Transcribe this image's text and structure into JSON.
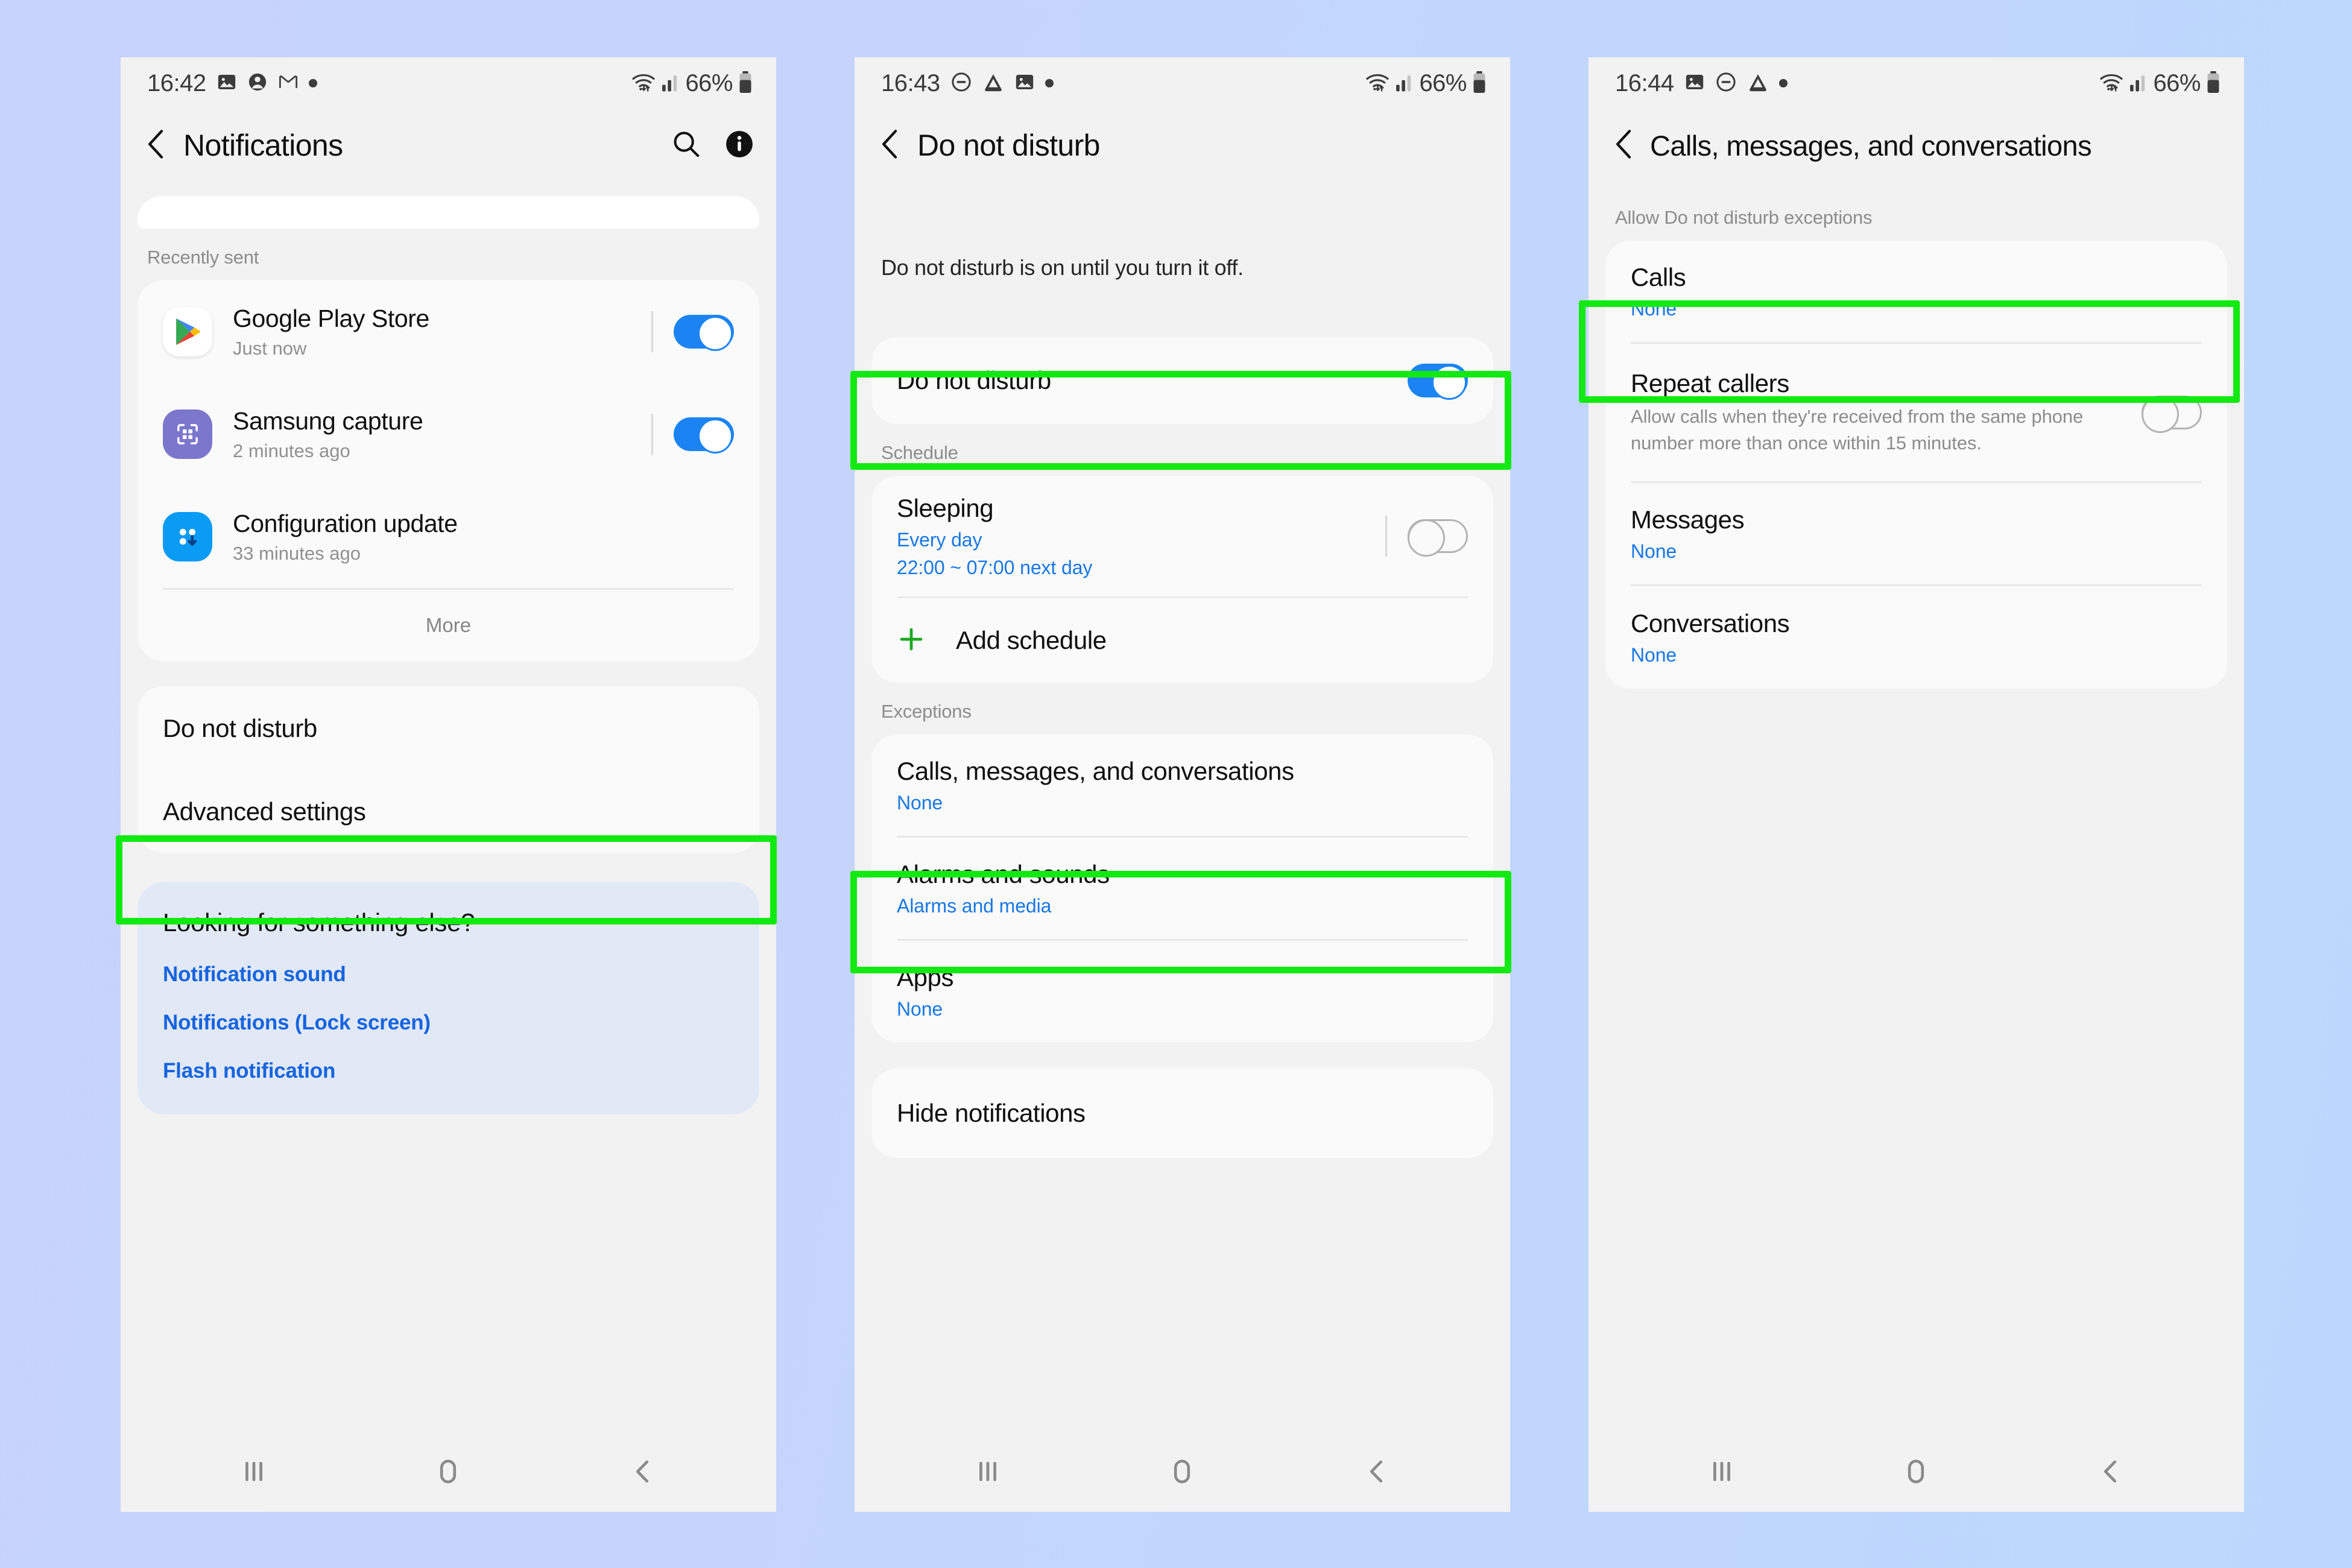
{
  "background": {
    "from": "#c7d2fd",
    "to": "#bcd7fd"
  },
  "highlight_color": "#11ea11",
  "accent_blue": "#1b84f2",
  "link_blue": "#1464e0",
  "phone1": {
    "status": {
      "time": "16:42",
      "battery": "66%",
      "icons": [
        "image-icon",
        "account-icon",
        "gmail-icon",
        "dot-icon"
      ]
    },
    "appbar": {
      "title": "Notifications",
      "actions": [
        "search-icon",
        "info-icon"
      ]
    },
    "section_label": "Recently sent",
    "notifications": [
      {
        "name": "Google Play Store",
        "time": "Just now",
        "icon": "google-play-icon",
        "toggle": "on"
      },
      {
        "name": "Samsung capture",
        "time": "2 minutes ago",
        "icon": "samsung-capture-icon",
        "toggle": "on"
      },
      {
        "name": "Configuration update",
        "time": "33 minutes ago",
        "icon": "configuration-update-icon",
        "toggle": "on"
      }
    ],
    "more_label": "More",
    "settings_rows": [
      {
        "label": "Do not disturb",
        "highlighted": true
      },
      {
        "label": "Advanced settings",
        "highlighted": false
      }
    ],
    "suggest": {
      "title": "Looking for something else?",
      "links": [
        "Notification sound",
        "Notifications (Lock screen)",
        "Flash notification"
      ]
    }
  },
  "phone2": {
    "status": {
      "time": "16:43",
      "battery": "66%",
      "icons": [
        "dnd-icon",
        "drive-icon",
        "image-icon",
        "dot-icon"
      ]
    },
    "appbar": {
      "title": "Do not disturb"
    },
    "note": "Do not disturb is on until you turn it off.",
    "dnd_row": {
      "label": "Do not disturb",
      "toggle": "on",
      "highlighted": true
    },
    "schedule_label": "Schedule",
    "schedule": {
      "title": "Sleeping",
      "sub1": "Every day",
      "sub2": "22:00 ~ 07:00 next day",
      "toggle": "off"
    },
    "add_schedule": {
      "label": "Add schedule",
      "icon": "plus-icon"
    },
    "exceptions_label": "Exceptions",
    "exceptions": [
      {
        "title": "Calls, messages, and conversations",
        "sub": "None",
        "highlighted": true
      },
      {
        "title": "Alarms and sounds",
        "sub": "Alarms and media",
        "highlighted": false
      },
      {
        "title": "Apps",
        "sub": "None",
        "highlighted": false
      }
    ],
    "hide_notifications": {
      "label": "Hide notifications"
    }
  },
  "phone3": {
    "status": {
      "time": "16:44",
      "battery": "66%",
      "icons": [
        "image-icon",
        "dnd-icon",
        "drive-icon",
        "dot-icon"
      ]
    },
    "appbar": {
      "title": "Calls, messages, and conversations"
    },
    "section_label": "Allow Do not disturb exceptions",
    "rows": [
      {
        "title": "Calls",
        "sub": "None",
        "highlighted": true,
        "toggle": null
      },
      {
        "title": "Repeat callers",
        "sub": "Allow calls when they're received from the same phone number more than once within 15 minutes.",
        "highlighted": false,
        "toggle": "off"
      },
      {
        "title": "Messages",
        "sub": "None",
        "highlighted": false,
        "toggle": null
      },
      {
        "title": "Conversations",
        "sub": "None",
        "highlighted": false,
        "toggle": null
      }
    ]
  },
  "navbar": {
    "recents": "recents-icon",
    "home": "home-icon",
    "back": "back-icon"
  }
}
